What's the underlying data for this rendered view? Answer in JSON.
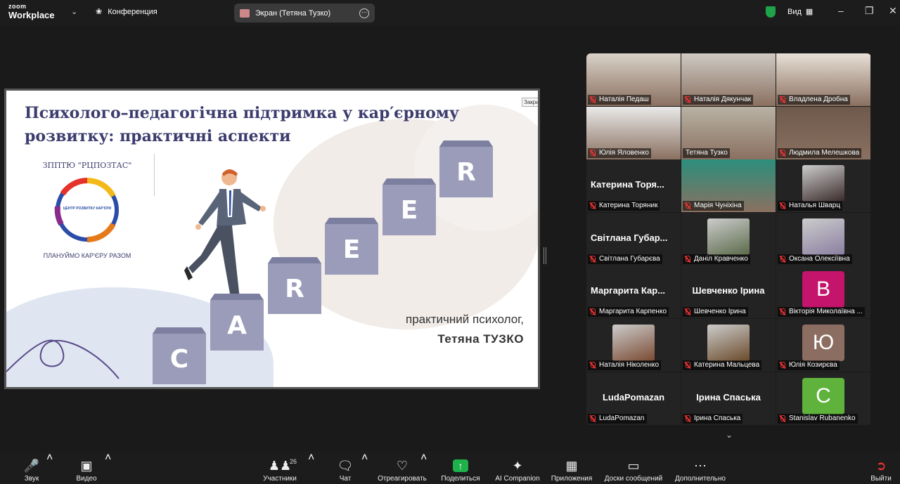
{
  "app": {
    "logo_top": "zoom",
    "logo_bottom": "Workplace",
    "conference_label": "Конференция",
    "screen_share_label": "Экран (Тетяна Тузко)",
    "view_label": "Вид"
  },
  "slide": {
    "title": "Психолого–педагогічна підтримка у кар′єрному розвитку: практичні аспекти",
    "close_tag": "Закрити",
    "logo_arc_top": "ЗППТЮ \"РЦПОЗТАС\"",
    "logo_center": "ЦЕНТР РОЗВИТКУ КАР'ЄРИ",
    "logo_arc_bottom": "ПЛАНУЙМО КАР'ЄРУ РАЗОМ",
    "speaker_role": "практичний психолог,",
    "speaker_name": "Тетяна ТУЗКО",
    "cubes": [
      "C",
      "A",
      "R",
      "E",
      "E",
      "R"
    ]
  },
  "participants": [
    {
      "name": "Наталія Педаш",
      "big": "",
      "kind": "photo",
      "color": "#d9d2c8",
      "muted": true
    },
    {
      "name": "Наталія Дякунчак",
      "big": "",
      "kind": "photo",
      "color": "#cfcac4",
      "muted": true
    },
    {
      "name": "Владлена Дробна",
      "big": "",
      "kind": "photo",
      "color": "#e8e0d6",
      "muted": true
    },
    {
      "name": "Юлія Яловенко",
      "big": "",
      "kind": "photo",
      "color": "#e9e9e9",
      "muted": true
    },
    {
      "name": "Тетяна Тузко",
      "big": "",
      "kind": "photo",
      "color": "#b8b2a4",
      "muted": false,
      "active": true
    },
    {
      "name": "Людмила Мелешкова",
      "big": "",
      "kind": "photo",
      "color": "#6e5a4c",
      "muted": true
    },
    {
      "name": "Катерина Торяник",
      "big": "Катерина Торя...",
      "kind": "text",
      "muted": true
    },
    {
      "name": "Марія Чуніхіна",
      "big": "",
      "kind": "photo",
      "color": "#2c8e7c",
      "muted": true
    },
    {
      "name": "Наталья Шварц",
      "big": "",
      "kind": "avatar",
      "color": "#3a2a2a",
      "muted": true
    },
    {
      "name": "Світлана Губарєва",
      "big": "Світлана Губар...",
      "kind": "text",
      "muted": true
    },
    {
      "name": "Даніл Кравченко",
      "big": "",
      "kind": "avatar",
      "color": "#5b6a4a",
      "muted": true
    },
    {
      "name": "Оксана Олексіївна",
      "big": "",
      "kind": "avatar",
      "color": "#8a7fa0",
      "muted": true
    },
    {
      "name": "Маргарита Карпенко",
      "big": "Маргарита Кар...",
      "kind": "text",
      "muted": true
    },
    {
      "name": "Шевченко Ірина",
      "big": "Шевченко Ірина",
      "kind": "text",
      "muted": true
    },
    {
      "name": "Вікторія Миколаївна ...",
      "big": "",
      "kind": "letter",
      "letter": "В",
      "color": "#c4146b",
      "muted": true
    },
    {
      "name": "Наталія Ніколенко",
      "big": "",
      "kind": "avatar",
      "color": "#7a4a32",
      "muted": true
    },
    {
      "name": "Катерина Мальцева",
      "big": "",
      "kind": "avatar",
      "color": "#6a4a2a",
      "muted": true
    },
    {
      "name": "Юлія Козирєва",
      "big": "",
      "kind": "letter",
      "letter": "Ю",
      "color": "#8c6d62",
      "muted": true
    },
    {
      "name": "LudaPomazan",
      "big": "LudaPomazan",
      "kind": "text",
      "muted": true
    },
    {
      "name": "Ірина Спаська",
      "big": "Ірина Спаська",
      "kind": "text",
      "muted": true
    },
    {
      "name": "Stanislav Rubanenko",
      "big": "",
      "kind": "letter",
      "letter": "C",
      "color": "#5fb33c",
      "muted": true
    }
  ],
  "toolbar": {
    "audio": "Звук",
    "video": "Видео",
    "participants": "Участники",
    "participants_count": "26",
    "chat": "Чат",
    "react": "Отреагировать",
    "share": "Поделиться",
    "ai": "AI Companion",
    "apps": "Приложения",
    "boards": "Доски сообщений",
    "more": "Дополнительно",
    "leave": "Выйти"
  }
}
